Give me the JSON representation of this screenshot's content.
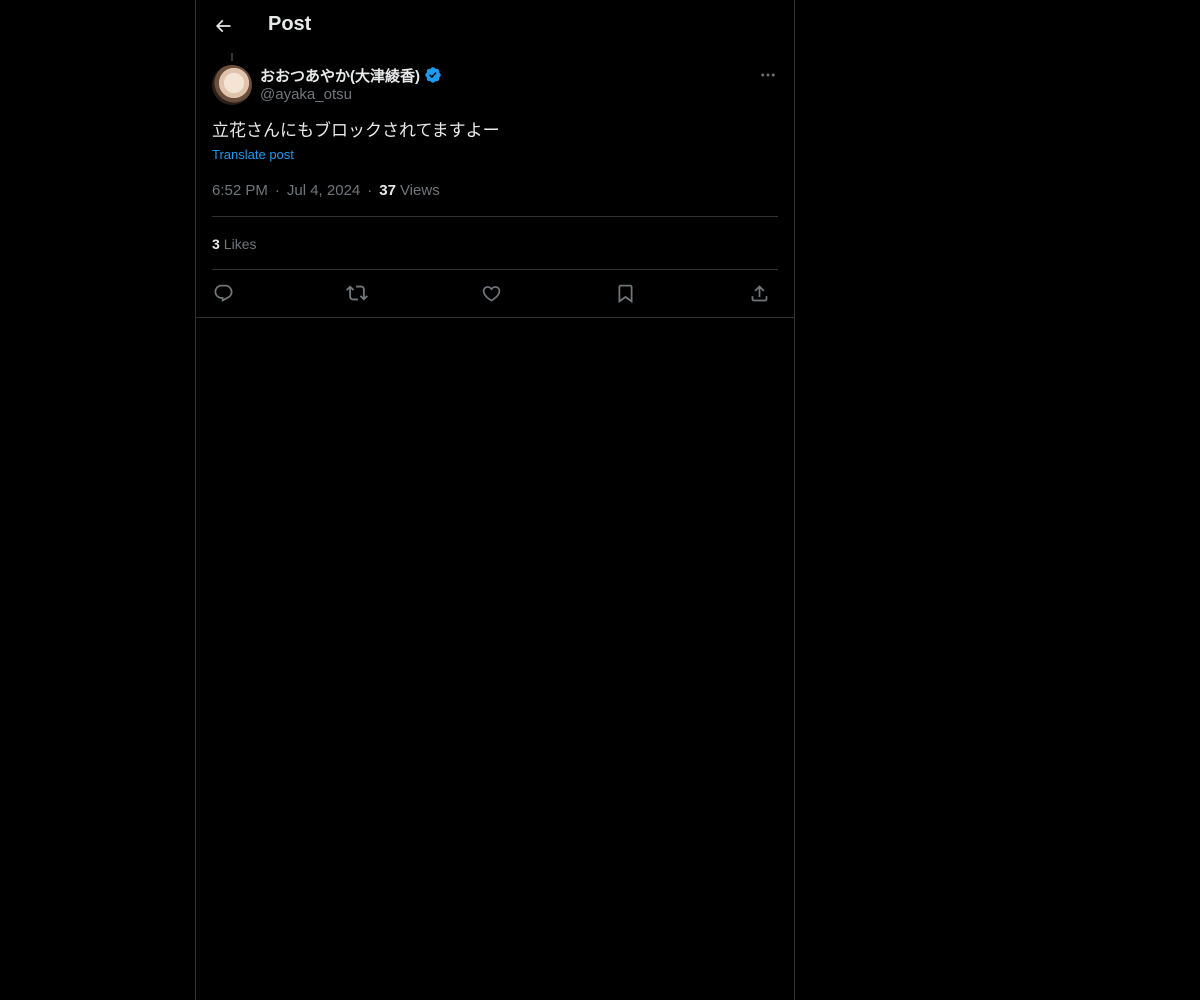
{
  "header": {
    "title": "Post",
    "back_icon": "arrow-left-icon"
  },
  "post": {
    "author": {
      "display_name": "おおつあやか(大津綾香)",
      "handle": "@ayaka_otsu",
      "verified": true,
      "verified_color": "#1d9bf0"
    },
    "text": "立花さんにもブロックされてますよー",
    "translate_label": "Translate post",
    "time": "6:52 PM",
    "date": "Jul 4, 2024",
    "views_count": "37",
    "views_label": "Views",
    "likes_count": "3",
    "likes_label": "Likes",
    "more_icon": "more-horizontal-icon"
  },
  "actions": [
    {
      "name": "reply",
      "icon": "reply-icon"
    },
    {
      "name": "repost",
      "icon": "repost-icon"
    },
    {
      "name": "like",
      "icon": "heart-icon"
    },
    {
      "name": "bookmark",
      "icon": "bookmark-icon"
    },
    {
      "name": "share",
      "icon": "share-icon"
    }
  ],
  "colors": {
    "background": "#000000",
    "text_primary": "#e7e9ea",
    "text_secondary": "#71767b",
    "link": "#1d9bf0",
    "border": "#2f3336"
  }
}
